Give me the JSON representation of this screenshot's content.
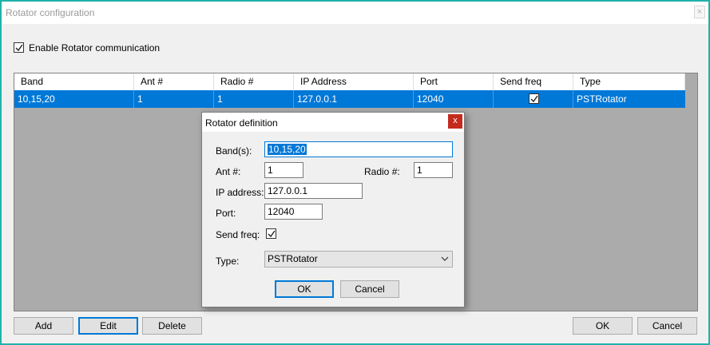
{
  "window": {
    "title": "Rotator configuration",
    "close_glyph": "×"
  },
  "enable": {
    "label": "Enable Rotator communication",
    "checked": true
  },
  "grid": {
    "columns": [
      "Band",
      "Ant #",
      "Radio #",
      "IP Address",
      "Port",
      "Send freq",
      "Type"
    ],
    "rows": [
      {
        "band": "10,15,20",
        "ant": "1",
        "radio": "1",
        "ip": "127.0.0.1",
        "port": "12040",
        "send_freq": true,
        "type": "PSTRotator"
      }
    ],
    "selection_color": "#0078d7"
  },
  "buttons": {
    "add": "Add",
    "edit": "Edit",
    "delete": "Delete",
    "ok": "OK",
    "cancel": "Cancel"
  },
  "dialog": {
    "title": "Rotator definition",
    "close_glyph": "x",
    "close_color": "#c42b1c",
    "bands_label": "Band(s):",
    "bands_value": "10,15,20",
    "ant_label": "Ant #:",
    "ant_value": "1",
    "radio_label": "Radio #:",
    "radio_value": "1",
    "ip_label": "IP address:",
    "ip_value": "127.0.0.1",
    "port_label": "Port:",
    "port_value": "12040",
    "sendfreq_label": "Send freq:",
    "sendfreq_checked": true,
    "type_label": "Type:",
    "type_value": "PSTRotator",
    "ok": "OK",
    "cancel": "Cancel"
  },
  "icons": {
    "checkmark": "checkmark-icon",
    "dropdown": "chevron-down-icon"
  },
  "colors": {
    "accent": "#0078d7",
    "frame": "#20b2aa",
    "grid_bg": "#ababab"
  }
}
